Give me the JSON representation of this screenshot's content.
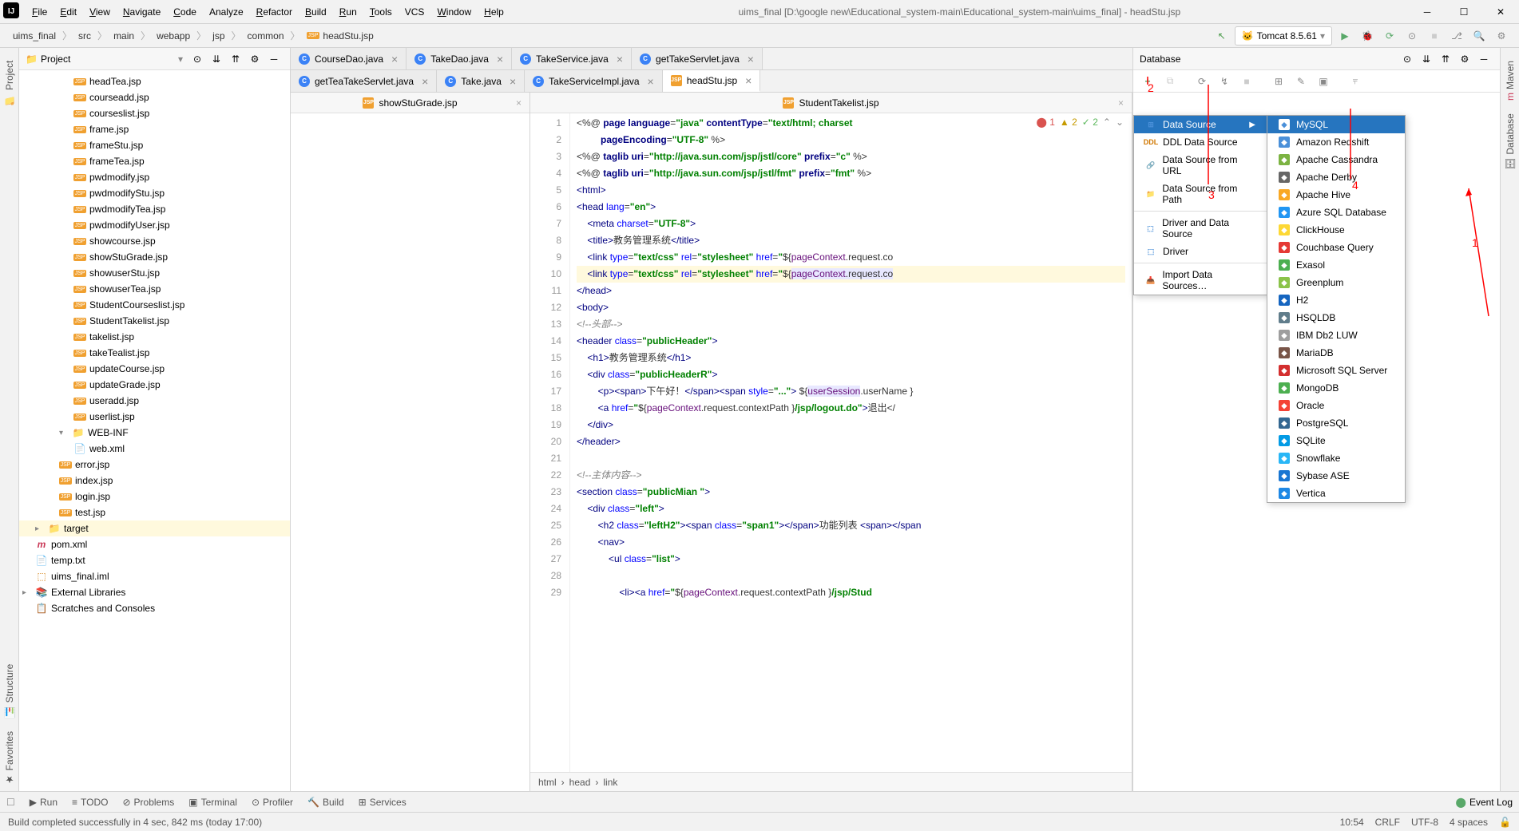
{
  "menu": [
    "File",
    "Edit",
    "View",
    "Navigate",
    "Code",
    "Analyze",
    "Refactor",
    "Build",
    "Run",
    "Tools",
    "VCS",
    "Window",
    "Help"
  ],
  "menu_mnemonics": [
    "F",
    "E",
    "V",
    "N",
    "C",
    "",
    "R",
    "B",
    "R",
    "T",
    "",
    "W",
    "H"
  ],
  "title": "uims_final [D:\\google new\\Educational_system-main\\Educational_system-main\\uims_final] - headStu.jsp",
  "breadcrumbs": [
    "uims_final",
    "src",
    "main",
    "webapp",
    "jsp",
    "common",
    "headStu.jsp"
  ],
  "run_config": "Tomcat 8.5.61",
  "project_label": "Project",
  "tree": [
    {
      "name": "headTea.jsp",
      "type": "jsp"
    },
    {
      "name": "courseadd.jsp",
      "type": "jsp"
    },
    {
      "name": "courseslist.jsp",
      "type": "jsp"
    },
    {
      "name": "frame.jsp",
      "type": "jsp"
    },
    {
      "name": "frameStu.jsp",
      "type": "jsp"
    },
    {
      "name": "frameTea.jsp",
      "type": "jsp"
    },
    {
      "name": "pwdmodify.jsp",
      "type": "jsp"
    },
    {
      "name": "pwdmodifyStu.jsp",
      "type": "jsp"
    },
    {
      "name": "pwdmodifyTea.jsp",
      "type": "jsp"
    },
    {
      "name": "pwdmodifyUser.jsp",
      "type": "jsp"
    },
    {
      "name": "showcourse.jsp",
      "type": "jsp"
    },
    {
      "name": "showStuGrade.jsp",
      "type": "jsp"
    },
    {
      "name": "showuserStu.jsp",
      "type": "jsp"
    },
    {
      "name": "showuserTea.jsp",
      "type": "jsp"
    },
    {
      "name": "StudentCourseslist.jsp",
      "type": "jsp"
    },
    {
      "name": "StudentTakelist.jsp",
      "type": "jsp"
    },
    {
      "name": "takelist.jsp",
      "type": "jsp"
    },
    {
      "name": "takeTealist.jsp",
      "type": "jsp"
    },
    {
      "name": "updateCourse.jsp",
      "type": "jsp"
    },
    {
      "name": "updateGrade.jsp",
      "type": "jsp"
    },
    {
      "name": "useradd.jsp",
      "type": "jsp"
    },
    {
      "name": "userlist.jsp",
      "type": "jsp"
    }
  ],
  "tree_webinf": {
    "label": "WEB-INF",
    "children": [
      {
        "name": "web.xml",
        "type": "xml"
      }
    ]
  },
  "tree_root_files": [
    {
      "name": "error.jsp",
      "type": "jsp"
    },
    {
      "name": "index.jsp",
      "type": "jsp"
    },
    {
      "name": "login.jsp",
      "type": "jsp"
    },
    {
      "name": "test.jsp",
      "type": "jsp"
    }
  ],
  "tree_footer": [
    {
      "name": "target",
      "type": "folder",
      "cls": "orange",
      "lvl": "lvl1",
      "arrow": "▸"
    },
    {
      "name": "pom.xml",
      "type": "m",
      "lvl": "lvl1"
    },
    {
      "name": "temp.txt",
      "type": "txt",
      "lvl": "lvl1"
    },
    {
      "name": "uims_final.iml",
      "type": "iml",
      "lvl": "lvl1"
    }
  ],
  "tree_libs": "External Libraries",
  "tree_scratches": "Scratches and Consoles",
  "tabs_row1": [
    {
      "name": "CourseDao.java",
      "type": "java"
    },
    {
      "name": "TakeDao.java",
      "type": "java"
    },
    {
      "name": "TakeService.java",
      "type": "java"
    },
    {
      "name": "getTakeServlet.java",
      "type": "java"
    }
  ],
  "tabs_row2": [
    {
      "name": "getTeaTakeServlet.java",
      "type": "java"
    },
    {
      "name": "Take.java",
      "type": "java"
    },
    {
      "name": "TakeServiceImpl.java",
      "type": "java"
    },
    {
      "name": "headStu.jsp",
      "type": "jsp",
      "active": true
    }
  ],
  "sub_tabs": [
    "showStuGrade.jsp",
    "StudentTakelist.jsp"
  ],
  "indicators": {
    "errors": "1",
    "warnings": "2",
    "ok": "2"
  },
  "crumb_path": [
    "html",
    "head",
    "link"
  ],
  "db_panel_title": "Database",
  "popup1": [
    {
      "label": "Data Source",
      "arrow": true,
      "selected": true
    },
    {
      "label": "DDL Data Source",
      "icon": "DDL",
      "color": "#d07700"
    },
    {
      "label": "Data Source from URL",
      "icon": "🔗"
    },
    {
      "label": "Data Source from Path",
      "icon": "📁"
    },
    {
      "sep": true
    },
    {
      "label": "Driver and Data Source",
      "icon": "⬚"
    },
    {
      "label": "Driver",
      "icon": "⬚"
    },
    {
      "sep": true
    },
    {
      "label": "Import Data Sources…",
      "icon": "📥"
    }
  ],
  "popup2": [
    {
      "label": "MySQL",
      "selected": true,
      "color": "#4a90d9"
    },
    {
      "label": "Amazon Redshift",
      "color": "#4a90d9"
    },
    {
      "label": "Apache Cassandra",
      "color": "#7cb342"
    },
    {
      "label": "Apache Derby",
      "color": "#666"
    },
    {
      "label": "Apache Hive",
      "color": "#f9a825"
    },
    {
      "label": "Azure SQL Database",
      "color": "#2196f3"
    },
    {
      "label": "ClickHouse",
      "color": "#fdd835"
    },
    {
      "label": "Couchbase Query",
      "color": "#e53935"
    },
    {
      "label": "Exasol",
      "color": "#4caf50"
    },
    {
      "label": "Greenplum",
      "color": "#8bc34a"
    },
    {
      "label": "H2",
      "color": "#1565c0"
    },
    {
      "label": "HSQLDB",
      "color": "#607d8b"
    },
    {
      "label": "IBM Db2 LUW",
      "color": "#9e9e9e"
    },
    {
      "label": "MariaDB",
      "color": "#795548"
    },
    {
      "label": "Microsoft SQL Server",
      "color": "#d32f2f"
    },
    {
      "label": "MongoDB",
      "color": "#4caf50"
    },
    {
      "label": "Oracle",
      "color": "#f44336"
    },
    {
      "label": "PostgreSQL",
      "color": "#336791"
    },
    {
      "label": "SQLite",
      "color": "#039be5"
    },
    {
      "label": "Snowflake",
      "color": "#29b6f6"
    },
    {
      "label": "Sybase ASE",
      "color": "#1976d2"
    },
    {
      "label": "Vertica",
      "color": "#1e88e5"
    }
  ],
  "bottom": [
    "Run",
    "TODO",
    "Problems",
    "Terminal",
    "Profiler",
    "Build",
    "Services"
  ],
  "event_log": "Event Log",
  "status_msg": "Build completed successfully in 4 sec, 842 ms (today 17:00)",
  "status_right": [
    "10:54",
    "CRLF",
    "UTF-8",
    "4 spaces"
  ],
  "side_left": [
    "Project"
  ],
  "side_left2": [
    "Structure",
    "Favorites"
  ],
  "side_right": [
    "Maven",
    "Database"
  ],
  "annotations": {
    "a1": "1",
    "a2": "2",
    "a3": "3",
    "a4": "4"
  },
  "code_lines": [
    {
      "n": 1,
      "html": "<span class='txt'>&lt;%@ </span><span class='kw'>page language</span><span class='txt'>=</span><span class='str'>\"java\"</span> <span class='kw'>contentType</span><span class='txt'>=</span><span class='str'>\"text/html; charset</span>"
    },
    {
      "n": 2,
      "html": "         <span class='kw'>pageEncoding</span><span class='txt'>=</span><span class='str'>\"UTF-8\"</span><span class='txt'> %&gt;</span>"
    },
    {
      "n": 3,
      "html": "<span class='txt'>&lt;%@ </span><span class='kw'>taglib uri</span><span class='txt'>=</span><span class='str'>\"http://java.sun.com/jsp/jstl/core\"</span> <span class='kw'>prefix</span><span class='txt'>=</span><span class='str'>\"c\"</span><span class='txt'> %&gt;</span>"
    },
    {
      "n": 4,
      "html": "<span class='txt'>&lt;%@ </span><span class='kw'>taglib uri</span><span class='txt'>=</span><span class='str'>\"http://java.sun.com/jsp/jstl/fmt\"</span> <span class='kw'>prefix</span><span class='txt'>=</span><span class='str'>\"fmt\"</span><span class='txt'> %&gt;</span>"
    },
    {
      "n": 5,
      "html": "<span class='tag'>&lt;html&gt;</span>"
    },
    {
      "n": 6,
      "html": "<span class='tag'>&lt;head </span><span class='attr'>lang</span><span class='txt'>=</span><span class='str'>\"en\"</span><span class='tag'>&gt;</span>"
    },
    {
      "n": 7,
      "html": "    <span class='tag'>&lt;meta </span><span class='attr'>charset</span><span class='txt'>=</span><span class='str'>\"UTF-8\"</span><span class='tag'>&gt;</span>"
    },
    {
      "n": 8,
      "html": "    <span class='tag'>&lt;title&gt;</span><span class='txt'>教务管理系统</span><span class='tag'>&lt;/title&gt;</span>"
    },
    {
      "n": 9,
      "html": "    <span class='tag'>&lt;link </span><span class='attr'>type</span><span class='txt'>=</span><span class='str'>\"text/css\"</span> <span class='attr'>rel</span><span class='txt'>=</span><span class='str'>\"stylesheet\"</span> <span class='attr'>href</span><span class='txt'>=</span><span class='str'>\"</span><span class='txt'>${</span><span class='var'>pageContext</span><span class='txt'>.request.co</span>"
    },
    {
      "n": 10,
      "html": "    <span class='tag'>&lt;link </span><span class='attr'>type</span><span class='txt'>=</span><span class='str'>\"text/css\"</span> <span class='attr'>rel</span><span class='txt'>=</span><span class='str'>\"stylesheet\"</span> <span class='attr'>href</span><span class='txt'>=</span><span class='str'>\"</span><span class='txt'>${</span><span class='hl'><span class='var'>pageContext</span><span class='txt'>.request.co</span></span>",
      "cls": "line10"
    },
    {
      "n": 11,
      "html": "<span class='tag'>&lt;/head&gt;</span>"
    },
    {
      "n": 12,
      "html": "<span class='tag'>&lt;body&gt;</span>"
    },
    {
      "n": 13,
      "html": "<span class='cmt'>&lt;!--头部--&gt;</span>"
    },
    {
      "n": 14,
      "html": "<span class='tag'>&lt;header </span><span class='attr'>class</span><span class='txt'>=</span><span class='str'>\"publicHeader\"</span><span class='tag'>&gt;</span>"
    },
    {
      "n": 15,
      "html": "    <span class='tag'>&lt;h1&gt;</span><span class='txt'>教务管理系统</span><span class='tag'>&lt;/h1&gt;</span>"
    },
    {
      "n": 16,
      "html": "    <span class='tag'>&lt;div </span><span class='attr'>class</span><span class='txt'>=</span><span class='str'>\"publicHeaderR\"</span><span class='tag'>&gt;</span>"
    },
    {
      "n": 17,
      "html": "        <span class='tag'>&lt;p&gt;&lt;span&gt;</span><span class='txt'>下午好！</span><span class='tag'>&lt;/span&gt;&lt;span </span><span class='attr'>style</span><span class='txt'>=</span><span class='str'>\"...\"</span><span class='tag'>&gt;</span><span class='txt'> ${</span><span class='hl'><span class='var'>userSession</span></span><span class='txt'>.userName }</span>"
    },
    {
      "n": 18,
      "html": "        <span class='tag'>&lt;a </span><span class='attr'>href</span><span class='txt'>=</span><span class='str'>\"</span><span class='txt'>${</span><span class='var'>pageContext</span><span class='txt'>.request.contextPath }</span><span class='str'>/jsp/logout.do\"</span><span class='tag'>&gt;</span><span class='txt'>退出&lt;/</span>"
    },
    {
      "n": 19,
      "html": "    <span class='tag'>&lt;/div&gt;</span>"
    },
    {
      "n": 20,
      "html": "<span class='tag'>&lt;/header&gt;</span>"
    },
    {
      "n": 21,
      "html": ""
    },
    {
      "n": 22,
      "html": "<span class='cmt'>&lt;!--主体内容--&gt;</span>"
    },
    {
      "n": 23,
      "html": "<span class='tag'>&lt;section </span><span class='attr'>class</span><span class='txt'>=</span><span class='str'>\"publicMian \"</span><span class='tag'>&gt;</span>"
    },
    {
      "n": 24,
      "html": "    <span class='tag'>&lt;div </span><span class='attr'>class</span><span class='txt'>=</span><span class='str'>\"left\"</span><span class='tag'>&gt;</span>"
    },
    {
      "n": 25,
      "html": "        <span class='tag'>&lt;h2 </span><span class='attr'>class</span><span class='txt'>=</span><span class='str'>\"leftH2\"</span><span class='tag'>&gt;&lt;span </span><span class='attr'>class</span><span class='txt'>=</span><span class='str'>\"span1\"</span><span class='tag'>&gt;&lt;/span&gt;</span><span class='txt'>功能列表 </span><span class='tag'>&lt;span&gt;&lt;/span</span>"
    },
    {
      "n": 26,
      "html": "        <span class='tag'>&lt;nav&gt;</span>"
    },
    {
      "n": 27,
      "html": "            <span class='tag'>&lt;ul </span><span class='attr'>class</span><span class='txt'>=</span><span class='str'>\"list\"</span><span class='tag'>&gt;</span>"
    },
    {
      "n": 28,
      "html": ""
    },
    {
      "n": 29,
      "html": "                <span class='tag'>&lt;li&gt;&lt;a </span><span class='attr'>href</span><span class='txt'>=</span><span class='str'>\"</span><span class='txt'>${</span><span class='var'>pageContext</span><span class='txt'>.request.contextPath }</span><span class='str'>/jsp/Stud</span>"
    }
  ]
}
